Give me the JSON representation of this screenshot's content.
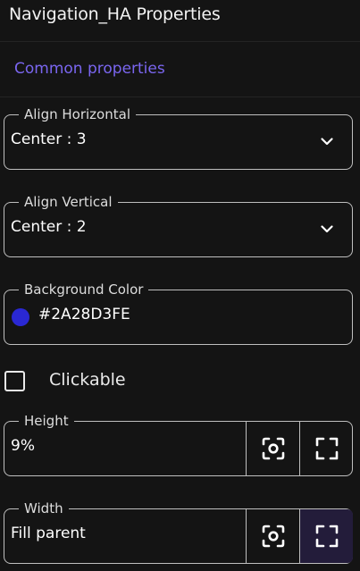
{
  "panel": {
    "title": "Navigation_HA Properties"
  },
  "section": {
    "label": "Common properties"
  },
  "align_horizontal": {
    "label": "Align Horizontal",
    "value": "Center : 3"
  },
  "align_vertical": {
    "label": "Align Vertical",
    "value": "Center : 2"
  },
  "background_color": {
    "label": "Background Color",
    "value": "#2A28D3FE",
    "swatch_color": "#2A28D3"
  },
  "clickable": {
    "label": "Clickable",
    "checked": false
  },
  "height": {
    "label": "Height",
    "value": "9%",
    "buttons": [
      "fit-content-icon",
      "fill-parent-icon"
    ]
  },
  "width": {
    "label": "Width",
    "value": "Fill parent",
    "buttons": [
      "fit-content-icon",
      "fill-parent-icon"
    ],
    "active": "fill-parent"
  },
  "colors": {
    "accent": "#7A66F0",
    "background": "#141414",
    "border": "#BFBFBF"
  }
}
